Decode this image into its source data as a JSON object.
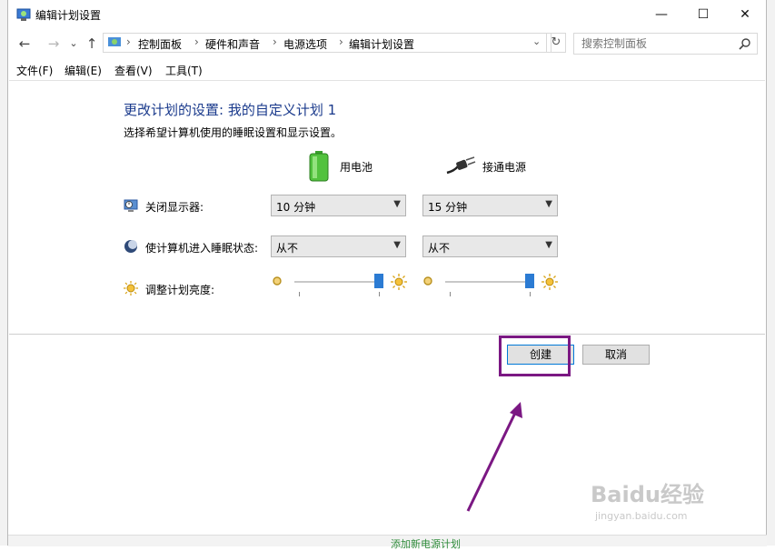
{
  "window": {
    "title": "编辑计划设置"
  },
  "controls": {
    "minimize": "—",
    "maximize": "☐",
    "close": "✕"
  },
  "nav": {
    "back": "←",
    "forward": "→",
    "recent": "⌄",
    "up": "↑",
    "refresh": "↻"
  },
  "breadcrumb": [
    "控制面板",
    "硬件和声音",
    "电源选项",
    "编辑计划设置"
  ],
  "search": {
    "placeholder": "搜索控制面板"
  },
  "menu": [
    "文件(F)",
    "编辑(E)",
    "查看(V)",
    "工具(T)"
  ],
  "main": {
    "heading": "更改计划的设置: 我的自定义计划 1",
    "subheading": "选择希望计算机使用的睡眠设置和显示设置。",
    "col_battery": "用电池",
    "col_plugged": "接通电源",
    "rows": [
      {
        "label": "关闭显示器:",
        "battery": "10 分钟",
        "plugged": "15 分钟"
      },
      {
        "label": "使计算机进入睡眠状态:",
        "battery": "从不",
        "plugged": "从不"
      },
      {
        "label": "调整计划亮度:"
      }
    ],
    "brightness": {
      "battery": 0.95,
      "plugged": 0.95
    }
  },
  "buttons": {
    "create": "创建",
    "cancel": "取消"
  },
  "watermark": {
    "logo": "Baidu经验",
    "url": "jingyan.baidu.com"
  },
  "bottom_link": "添加新电源计划",
  "colors": {
    "heading": "#1a3a8c",
    "highlight": "#7b1883",
    "accent": "#0078d7"
  }
}
